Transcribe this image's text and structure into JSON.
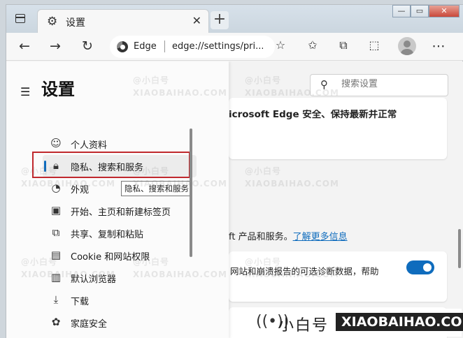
{
  "tab": {
    "title": "设置"
  },
  "addressbar": {
    "brand": "Edge",
    "url": "edge://settings/pri..."
  },
  "search": {
    "placeholder": "搜索设置"
  },
  "sidebar": {
    "title": "设置",
    "items": [
      {
        "label": "个人资料",
        "icon": "profile-icon"
      },
      {
        "label": "隐私、搜索和服务",
        "icon": "lock-icon"
      },
      {
        "label": "外观",
        "icon": "palette-icon"
      },
      {
        "label": "开始、主页和新建标签页",
        "icon": "newtab-icon"
      },
      {
        "label": "共享、复制和粘贴",
        "icon": "share-icon"
      },
      {
        "label": "Cookie 和网站权限",
        "icon": "cookie-icon"
      },
      {
        "label": "默认浏览器",
        "icon": "browser-icon"
      },
      {
        "label": "下载",
        "icon": "download-icon"
      },
      {
        "label": "家庭安全",
        "icon": "family-icon"
      }
    ]
  },
  "tooltip": "隐私、搜索和服务",
  "main": {
    "card1_heading": "icrosoft Edge 安全、保持最新并正常",
    "info_text": "ft 产品和服务。",
    "info_link": "了解更多信息",
    "diag_text": "网站和崩溃报告的可选诊断数据，帮助"
  },
  "watermark": {
    "cn": "@小白号",
    "en": "XIAOBAIHAO.COM"
  },
  "brandbar": {
    "cn": "小白号",
    "en": "XIAOBAIHAO.COM"
  },
  "colors": {
    "accent": "#0f6cbd",
    "highlight": "#c0282d"
  }
}
